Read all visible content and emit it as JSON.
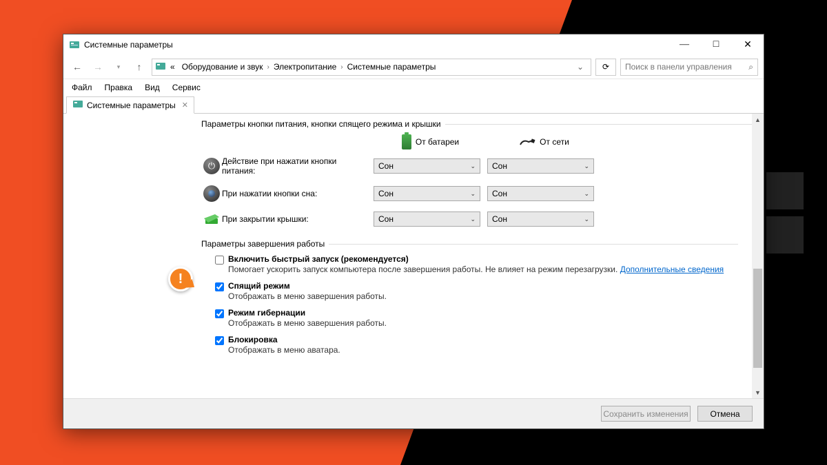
{
  "window": {
    "title": "Системные параметры"
  },
  "breadcrumb": {
    "prefix": "«",
    "items": [
      "Оборудование и звук",
      "Электропитание",
      "Системные параметры"
    ]
  },
  "search": {
    "placeholder": "Поиск в панели управления"
  },
  "menu": [
    "Файл",
    "Правка",
    "Вид",
    "Сервис"
  ],
  "tab": {
    "label": "Системные параметры"
  },
  "section1": {
    "header": "Параметры кнопки питания, кнопки спящего режима и крышки",
    "col_battery": "От батареи",
    "col_ac": "От сети",
    "rows": [
      {
        "label": "Действие при нажатии кнопки питания:",
        "battery": "Сон",
        "ac": "Сон"
      },
      {
        "label": "При нажатии кнопки сна:",
        "battery": "Сон",
        "ac": "Сон"
      },
      {
        "label": "При закрытии крышки:",
        "battery": "Сон",
        "ac": "Сон"
      }
    ]
  },
  "section2": {
    "header": "Параметры завершения работы",
    "items": [
      {
        "checked": false,
        "title": "Включить быстрый запуск (рекомендуется)",
        "desc": "Помогает ускорить запуск компьютера после завершения работы. Не влияет на режим перезагрузки.",
        "link": "Дополнительные сведения"
      },
      {
        "checked": true,
        "title": "Спящий режим",
        "desc": "Отображать в меню завершения работы."
      },
      {
        "checked": true,
        "title": "Режим гибернации",
        "desc": "Отображать в меню завершения работы."
      },
      {
        "checked": true,
        "title": "Блокировка",
        "desc": "Отображать в меню аватара."
      }
    ]
  },
  "footer": {
    "save": "Сохранить изменения",
    "cancel": "Отмена"
  },
  "callout": {
    "glyph": "!"
  }
}
